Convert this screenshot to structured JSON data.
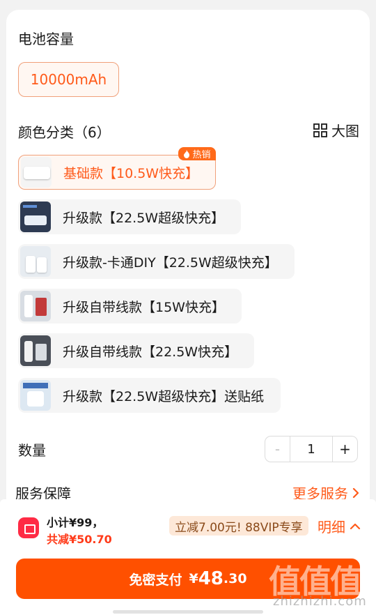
{
  "capacity": {
    "title": "电池容量",
    "selected": "10000mAh"
  },
  "color": {
    "title": "颜色分类（6）",
    "big_image_label": "大图",
    "hot_badge": "热销",
    "options": [
      {
        "label": "基础款【10.5W快充】",
        "selected": true
      },
      {
        "label": "升级款【22.5W超级快充】",
        "selected": false
      },
      {
        "label": "升级款-卡通DIY【22.5W超级快充】",
        "selected": false
      },
      {
        "label": "升级自带线款【15W快充】",
        "selected": false
      },
      {
        "label": "升级自带线款【22.5W快充】",
        "selected": false
      },
      {
        "label": "升级款【22.5W超级快充】送贴纸",
        "selected": false
      }
    ]
  },
  "quantity": {
    "title": "数量",
    "value": "1",
    "minus": "-",
    "plus": "+"
  },
  "service": {
    "title": "服务保障",
    "more": "更多服务"
  },
  "summary": {
    "subtotal": "小计¥99，",
    "saving": "共减¥50.70",
    "vip_tag": "立减7.00元! 88VIP专享",
    "detail": "明细"
  },
  "pay": {
    "label": "免密支付",
    "currency": "¥",
    "integer": "48",
    "decimal": ".30"
  },
  "watermark": {
    "text": "值值值",
    "url": "zhizhizhi.com"
  },
  "colors": {
    "accent": "#ff5000",
    "accent_text": "#ff5a1a",
    "vip_bg": "#fde8d8"
  }
}
